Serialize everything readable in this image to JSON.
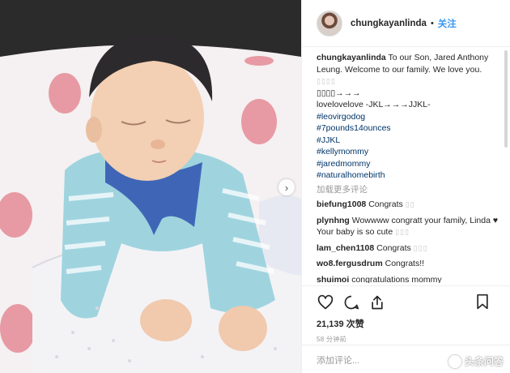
{
  "post": {
    "username": "chungkayanlinda",
    "separator": "•",
    "follow_label": "关注",
    "caption": {
      "username": "chungkayanlinda",
      "text": "To our Son, Jared Anthony Leung. Welcome to our family. We love you.",
      "glyph_line_1": "▯▯▯▯",
      "arrow_line": "▯▯▯▯→→→",
      "lovelove": "lovelovelove -JKL→→→JJKL-",
      "hashtags": [
        "#leovirgodog",
        "#7pounds14ounces",
        "#JJKL",
        "#kellymommy",
        "#jaredmommy",
        "#naturalhomebirth"
      ]
    },
    "load_more_label": "加载更多评论",
    "comments": [
      {
        "username": "biefung1008",
        "text": "Congrats",
        "glyphs": "▯▯"
      },
      {
        "username": "plynhng",
        "text": "Wowwww congratt your family, Linda ♥ Your baby is so cute",
        "glyphs": "▯▯▯"
      },
      {
        "username": "lam_chen1108",
        "text": "Congrats",
        "glyphs": "▯▯▯"
      },
      {
        "username": "wo8.fergusdrum",
        "text": "Congrats!!",
        "glyphs": ""
      },
      {
        "username": "shuimoi",
        "text": "congratulations mommy @chungkayanlinda ❤❤❤",
        "glyphs": ""
      }
    ],
    "likes_label": "21,139 次赞",
    "time_label": "58 分钟前",
    "add_comment_placeholder": "添加评论..."
  },
  "photo": {
    "next_glyph": "›"
  },
  "watermark": {
    "text": "头条问答"
  },
  "icons": {
    "like": "heart-icon",
    "comment": "comment-bubble-icon",
    "share": "share-icon",
    "save": "bookmark-icon"
  },
  "colors": {
    "link_blue": "#3897f0",
    "hashtag_blue": "#003569",
    "muted_gray": "#999999",
    "text": "#262626"
  }
}
